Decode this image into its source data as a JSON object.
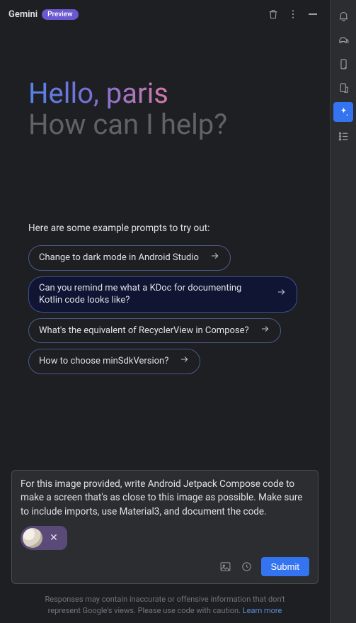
{
  "header": {
    "title": "Gemini",
    "badge": "Preview"
  },
  "greeting": {
    "line1": "Hello, paris",
    "line2": "How can I help?"
  },
  "examples": {
    "intro": "Here are some example prompts to try out:",
    "prompts": [
      "Change to dark mode in Android Studio",
      "Can you remind me what a KDoc for documenting Kotlin code looks like?",
      "What's the equivalent of RecyclerView in Compose?",
      "How to choose minSdkVersion?"
    ]
  },
  "input": {
    "text": "For this image provided, write Android Jetpack Compose code to make a screen that's as close to this image as possible. Make sure to include imports, use Material3, and document the code.",
    "submit_label": "Submit"
  },
  "disclaimer": {
    "text": "Responses may contain inaccurate or offensive information that don't represent Google's views. Please use code with caution. ",
    "link_label": "Learn more"
  }
}
